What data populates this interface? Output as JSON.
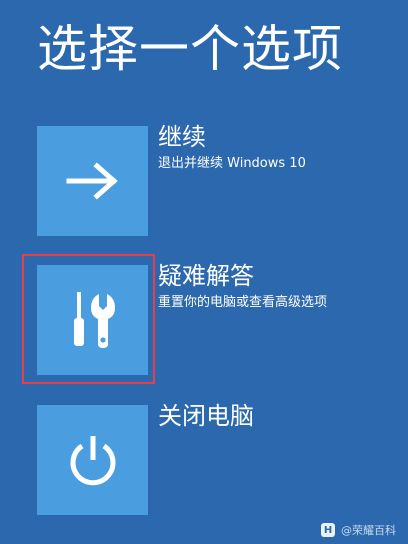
{
  "page": {
    "title": "选择一个选项"
  },
  "options": [
    {
      "label": "继续",
      "description": "退出并继续 Windows 10",
      "icon": "arrow-right-icon"
    },
    {
      "label": "疑难解答",
      "description": "重置你的电脑或查看高级选项",
      "icon": "tools-icon"
    },
    {
      "label": "关闭电脑",
      "description": "",
      "icon": "power-icon"
    }
  ],
  "highlight": {
    "target": "疑难解答",
    "color": "#e8404a"
  },
  "watermark": {
    "logo_text": "H",
    "text": "@荣耀百科"
  },
  "colors": {
    "background": "#2b68ad",
    "tile": "#4a9ee0",
    "text": "#ffffff"
  }
}
